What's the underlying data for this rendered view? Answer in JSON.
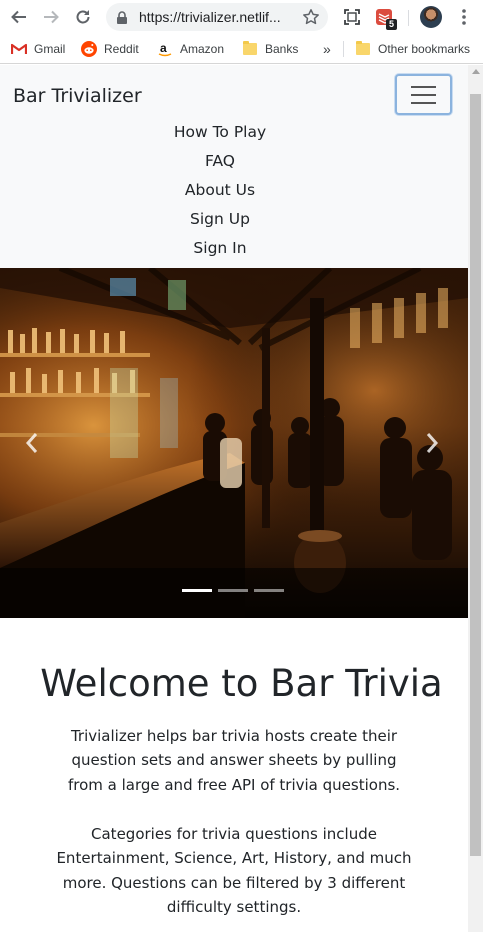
{
  "browser": {
    "url": "https://trivializer.netlif...",
    "extension_badge": "5",
    "bookmarks": [
      {
        "label": "Gmail",
        "icon": "gmail-icon"
      },
      {
        "label": "Reddit",
        "icon": "reddit-icon"
      },
      {
        "label": "Amazon",
        "icon": "amazon-icon"
      },
      {
        "label": "Banks",
        "icon": "folder-icon"
      }
    ],
    "overflow_label": "»",
    "other_bookmarks": "Other bookmarks"
  },
  "navbar": {
    "brand": "Bar Trivializer",
    "links": [
      "How To Play",
      "FAQ",
      "About Us",
      "Sign Up",
      "Sign In"
    ]
  },
  "carousel": {
    "slide_count": 3,
    "active_index": 0
  },
  "main": {
    "heading": "Welcome to Bar Trivia",
    "paragraph1_lines": [
      "Trivializer helps bar trivia hosts create their",
      "question sets and answer sheets by pulling",
      "from a large and free API of trivia questions."
    ],
    "paragraph2_lines": [
      "Categories for trivia questions include",
      "Entertainment, Science, Art, History, and much",
      "more. Questions can be filtered by 3 different",
      "difficulty settings."
    ]
  },
  "colors": {
    "navbar_bg": "#f8f9fa",
    "text": "#212529",
    "toggler_focus": "#8bb3de"
  }
}
